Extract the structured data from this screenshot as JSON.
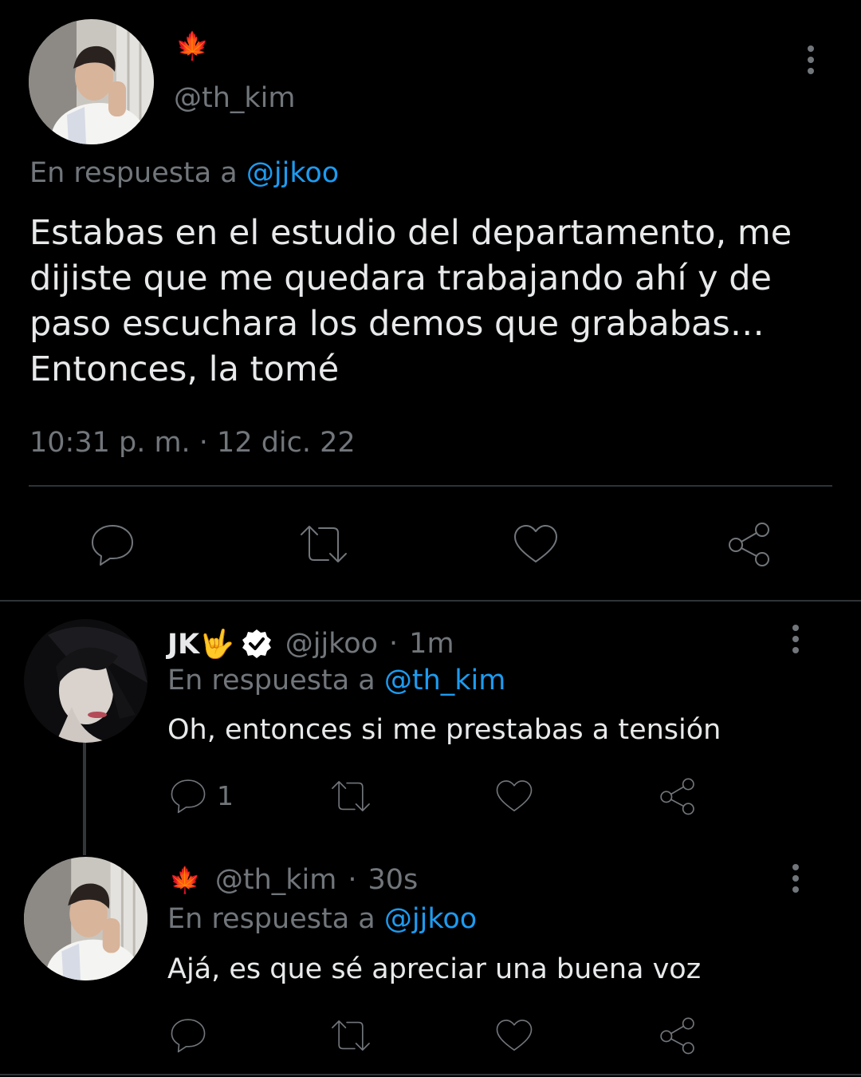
{
  "main_tweet": {
    "display_name_emoji": "🍁",
    "handle": "@th_kim",
    "reply_prefix": "En respuesta a",
    "reply_to": "@jjkoo",
    "body": "Estabas en el estudio del departamento, me dijiste que me quedara trabajando ahí y de paso escuchara los demos que grababas… Entonces, la tomé",
    "timestamp": "10:31 p. m. · 12 dic. 22"
  },
  "replies": [
    {
      "display_name": "JK🤟",
      "verified": true,
      "handle": "@jjkoo",
      "separator": "·",
      "time": "1m",
      "reply_prefix": "En respuesta a",
      "reply_to": "@th_kim",
      "body": "Oh, entonces si me prestabas a tensión",
      "reply_count": "1"
    },
    {
      "display_name": "🍁",
      "handle": "@th_kim",
      "separator": "·",
      "time": "30s",
      "reply_prefix": "En respuesta a",
      "reply_to": "@jjkoo",
      "body": "Ajá, es que sé apreciar una buena voz",
      "reply_count": ""
    }
  ],
  "colors": {
    "background": "#000000",
    "text": "#e7e9ea",
    "secondary": "#71767b",
    "accent": "#1d9bf0",
    "divider": "#2f3336"
  },
  "icons": [
    "more-icon",
    "reply-icon",
    "retweet-icon",
    "like-icon",
    "share-icon",
    "verified-icon",
    "maple-leaf-icon"
  ]
}
